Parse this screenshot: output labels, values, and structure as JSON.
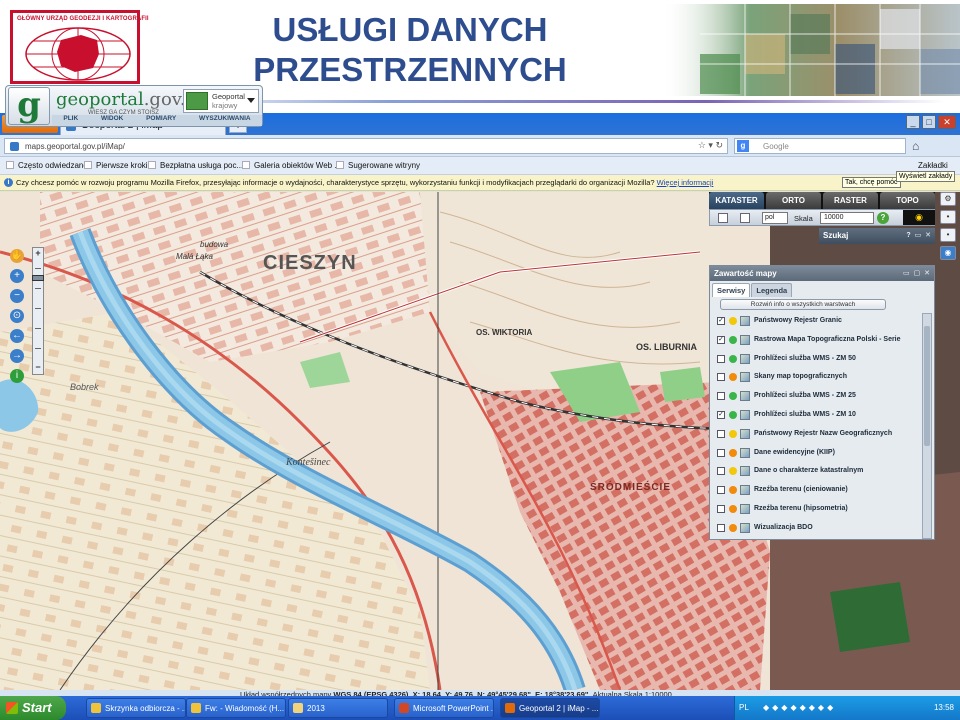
{
  "slide": {
    "title_line1": "USŁUGI DANYCH",
    "title_line2": "PRZESTRZENNYCH",
    "logo_text": "GŁÓWNY URZĄD GEODEZJI I KARTOGRAFII"
  },
  "colors": {
    "title": "#2e4d8f",
    "accent_red": "#c8102e",
    "firefox_orange": "#e16a0a",
    "river": "#8cc7e8"
  },
  "browser": {
    "firefox_label": "Firefox",
    "tab_title": "Geoportal 2 | iMap",
    "new_tab": "+",
    "url": "maps.geoportal.gov.pl/iMap/",
    "search_placeholder": "Google",
    "bookmarks": [
      "Często odwiedzane",
      "Pierwsze kroki",
      "Bezpłatna usługa poc...",
      "Galeria obiektów Web ...",
      "Sugerowane witryny"
    ],
    "bookmarks_menu": "Zakładki",
    "tooltip_bookmarks": "Wyświetl zakłady",
    "infobar_text": "Czy chcesz pomóc w rozwoju programu Mozilla Firefox, przesyłając informacje o wydajności, charakterystyce sprzętu, wykorzystaniu funkcji i modyfikacjach przeglądarki do organizacji Mozilla?",
    "infobar_link": "Więcej informacji",
    "infobar_button": "Tak, chcę pomóc"
  },
  "geoportal": {
    "logo_g": "g",
    "name_prefix": "geoportal",
    "name_suffix": ".gov.pl",
    "tagline": "WIESZ GA CZYM STOISZ",
    "select_line1": "Geoportal",
    "select_line2": "krajowy",
    "menu": [
      "PLIK",
      "WIDOK",
      "POMIARY",
      "WYSZUKIWANIA"
    ],
    "zoom_plus": "+",
    "zoom_minus": "−"
  },
  "panel": {
    "tabs": [
      "KATASTER",
      "ORTO",
      "RASTER",
      "TOPO"
    ],
    "lang": "pol",
    "scale_label": "Skala",
    "scale_value": "10000",
    "help": "?",
    "search_title": "Szukaj",
    "content_title": "Zawartość mapy",
    "subtabs": [
      "Serwisy",
      "Legenda"
    ],
    "expand_button": "Rozwiń info o wszystkich warstwach",
    "layers": [
      {
        "name": "Państwowy Rejestr Granic",
        "checked": true,
        "dot": "#f2c80a"
      },
      {
        "name": "Rastrowa Mapa Topograficzna Polski - Serie",
        "checked": true,
        "dot": "#39b54a"
      },
      {
        "name": "Prohlížeci služba WMS - ZM 50",
        "checked": false,
        "dot": "#39b54a"
      },
      {
        "name": "Skany map topograficznych",
        "checked": false,
        "dot": "#f28a0a"
      },
      {
        "name": "Prohlížeci služba WMS - ZM 25",
        "checked": false,
        "dot": "#39b54a"
      },
      {
        "name": "Prohlížeci služba WMS - ZM 10",
        "checked": true,
        "dot": "#39b54a"
      },
      {
        "name": "Państwowy Rejestr Nazw Geograficznych",
        "checked": false,
        "dot": "#f2c80a"
      },
      {
        "name": "Dane ewidencyjne (KIIP)",
        "checked": false,
        "dot": "#f28a0a"
      },
      {
        "name": "Dane o charakterze katastralnym",
        "checked": false,
        "dot": "#f2c80a"
      },
      {
        "name": "Rzeźba terenu (cieniowanie)",
        "checked": false,
        "dot": "#f28a0a"
      },
      {
        "name": "Rzeźba terenu (hipsometria)",
        "checked": false,
        "dot": "#f28a0a"
      },
      {
        "name": "Wizualizacja BDO",
        "checked": false,
        "dot": "#f28a0a"
      }
    ]
  },
  "map": {
    "labels": [
      "CIESZYN",
      "Kontešinec",
      "budowa",
      "Malá Łąka",
      "Bobrek",
      "ŚRÓDMIEŚCIE",
      "OS. WIKTORIA",
      "OS. LIBURNIA"
    ]
  },
  "coords": {
    "label": "Układ współrzędnych mapy",
    "system": "WGS 84 (EPSG 4326)",
    "x": "X: 18.64",
    "y": "Y: 49.76",
    "n": "N: 49°45'29.68\"",
    "e": "E: 18°38'23.69\"",
    "scale": "Aktualna Skala 1:10000"
  },
  "taskbar": {
    "start": "Start",
    "tasks": [
      {
        "label": "Skrzynka odbiorcza - ...",
        "color": "#f0c43a"
      },
      {
        "label": "Fw: - Wiadomość (H...",
        "color": "#f0c43a"
      },
      {
        "label": "2013",
        "color": "#f0d37a"
      },
      {
        "label": "Microsoft PowerPoint ...",
        "color": "#d24726"
      },
      {
        "label": "Geoportal 2 | iMap - ...",
        "color": "#e16a0a"
      }
    ],
    "lang": "PL",
    "clock": "13:58"
  }
}
